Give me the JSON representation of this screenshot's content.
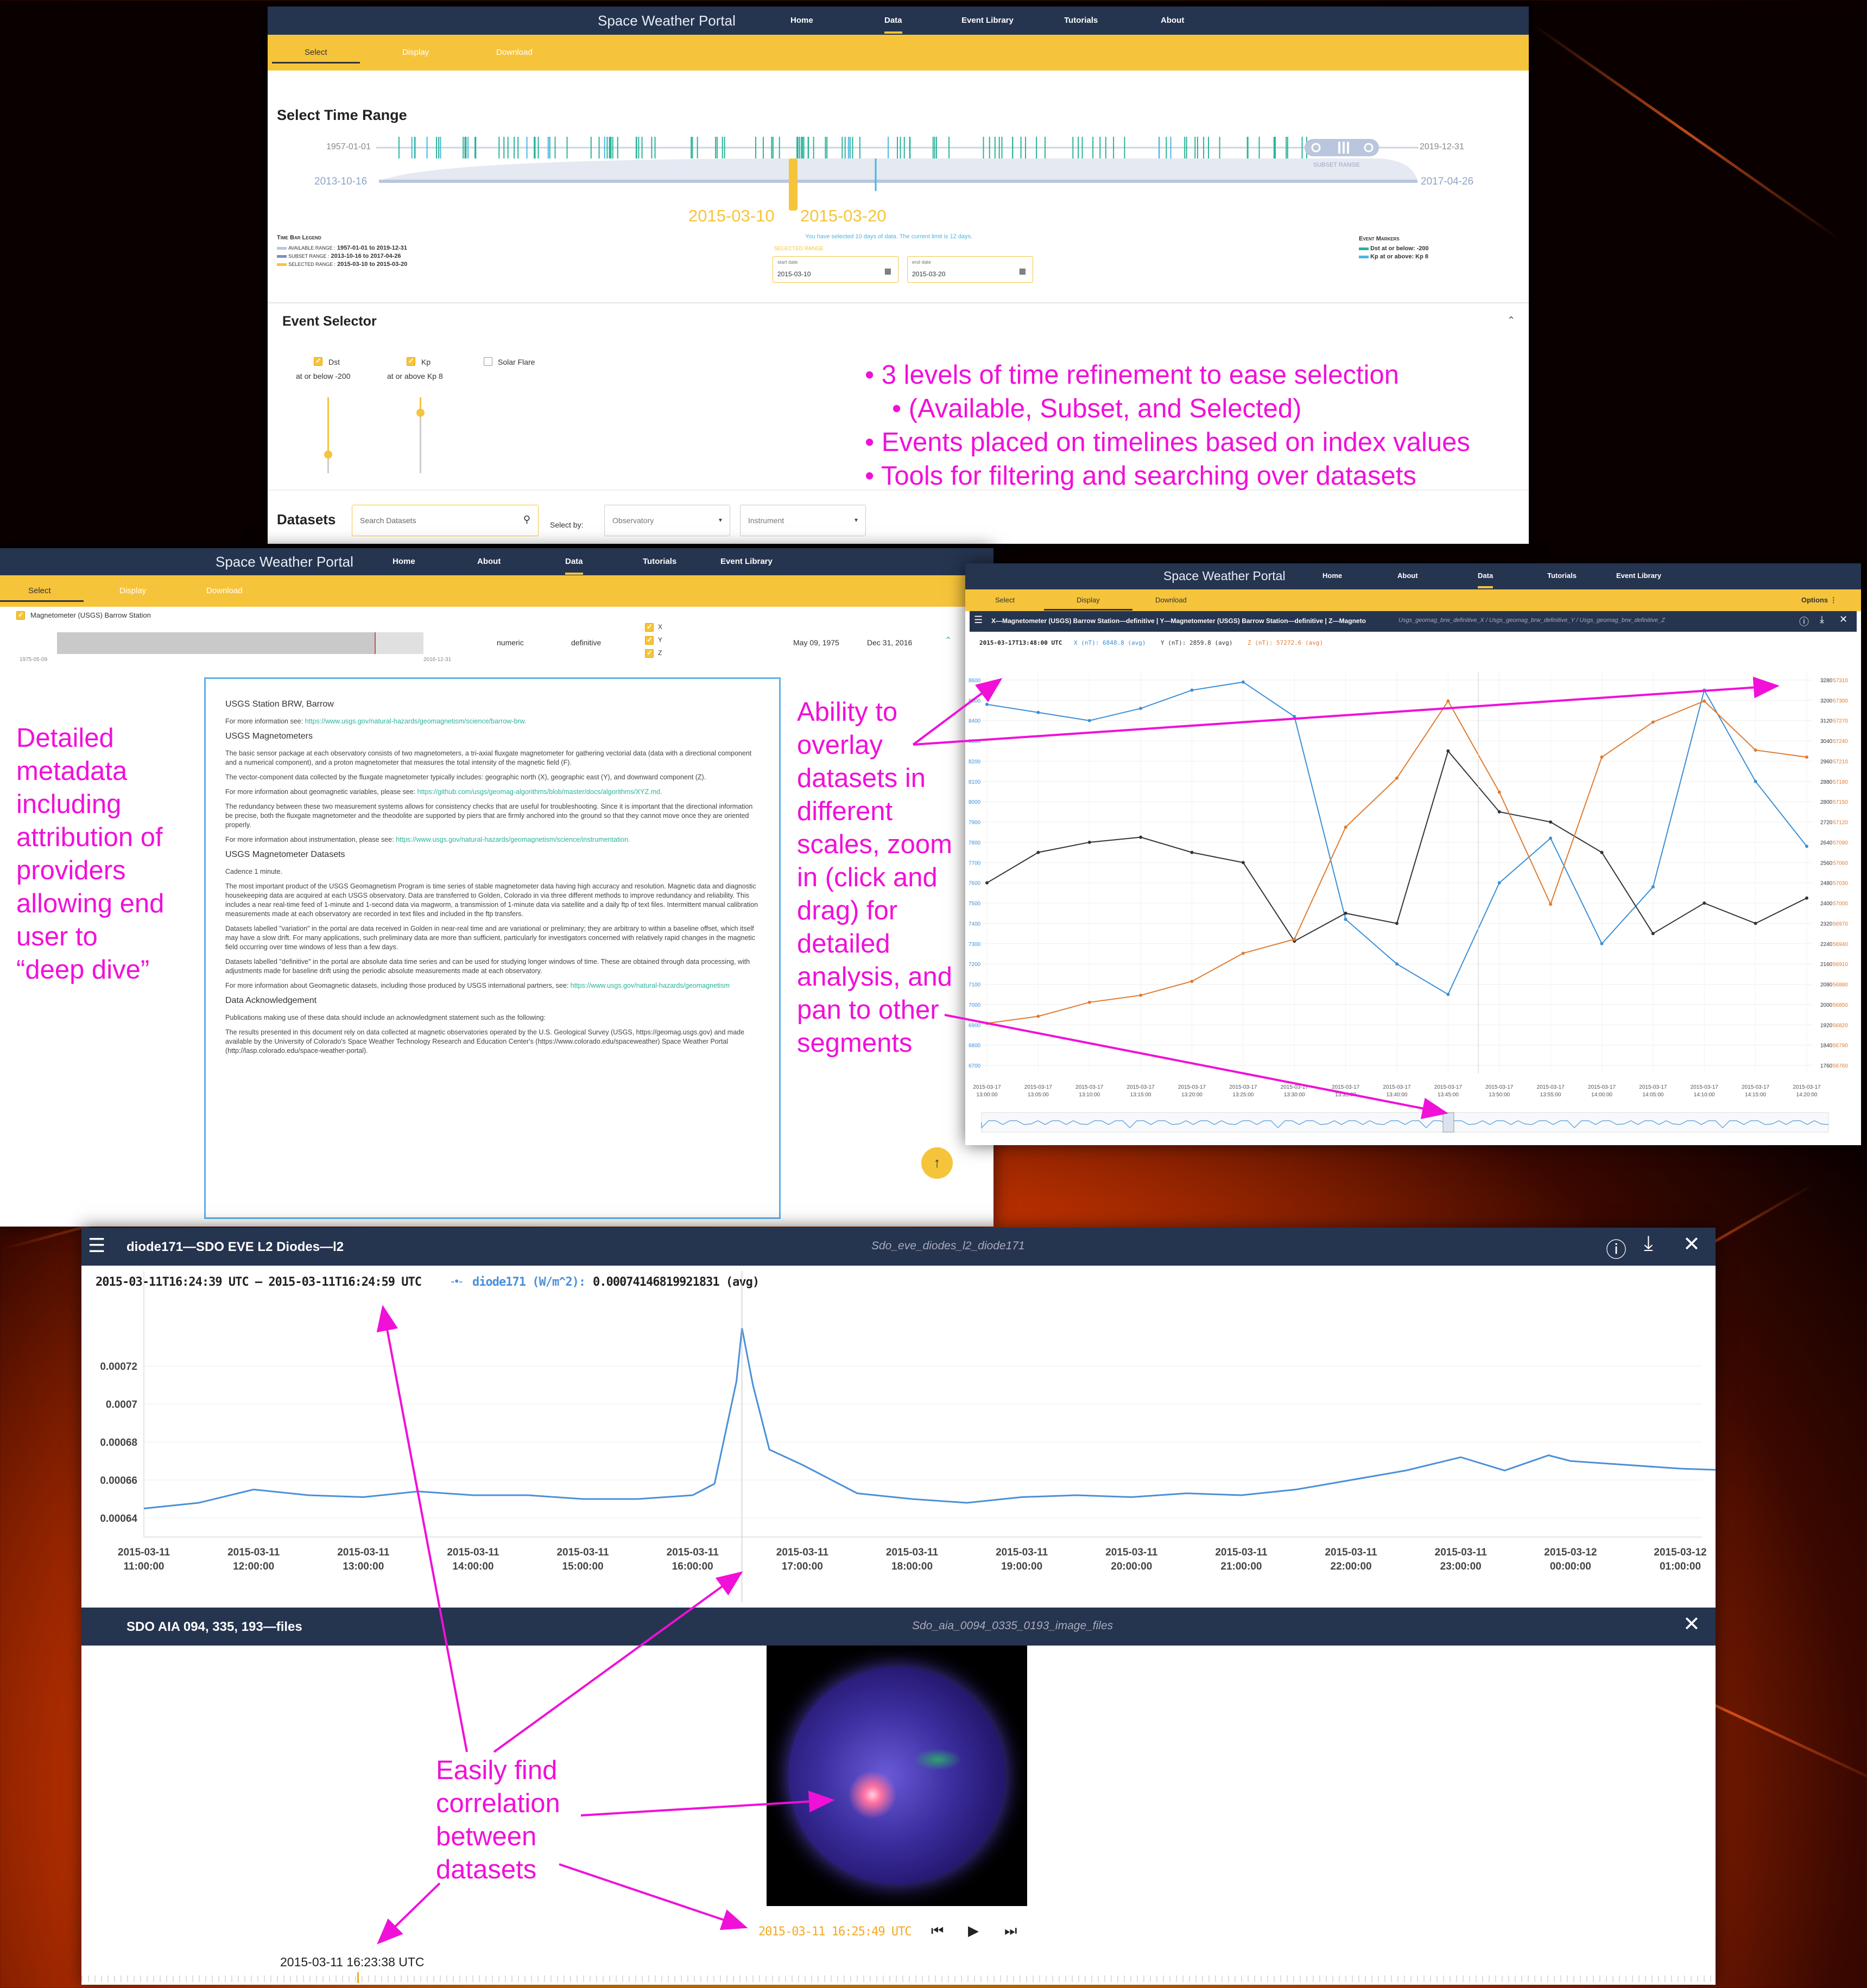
{
  "panel_top": {
    "brand": "Space Weather Portal",
    "nav": [
      "Home",
      "Data",
      "Event Library",
      "Tutorials",
      "About"
    ],
    "subtabs": [
      "Select",
      "Display",
      "Download"
    ],
    "heading": "Select Time Range",
    "available_start": "1957-01-01",
    "available_end": "2019-12-31",
    "subset_start": "2013-10-16",
    "subset_end": "2017-04-26",
    "subset_label": "SUBSET RANGE",
    "selected_start": "2015-03-10",
    "selected_end": "2015-03-20",
    "selected_note": "You have selected 10 days of data. The current limit is 12 days.",
    "selected_range_label": "SELECTED RANGE",
    "start_label": "start date",
    "end_label": "end date",
    "legend_title": "Time Bar Legend",
    "legend": [
      {
        "label": "AVAILABLE RANGE :",
        "value": "1957-01-01 to 2019-12-31",
        "color": "#b9c6dd"
      },
      {
        "label": "SUBSET RANGE :",
        "value": "2013-10-16 to 2017-04-26",
        "color": "#7d90b8"
      },
      {
        "label": "SELECTED RANGE :",
        "value": "2015-03-10 to 2015-03-20",
        "color": "#f6c43b"
      }
    ],
    "markers_title": "Event Markers",
    "markers": [
      {
        "label": "Dst at or below: -200",
        "color": "#2bb39a"
      },
      {
        "label": "Kp at or above: Kp 8",
        "color": "#48b6e6"
      }
    ],
    "event_selector": "Event Selector",
    "events": [
      {
        "name": "Dst",
        "sub": "at or below -200",
        "checked": true,
        "level": 0.25
      },
      {
        "name": "Kp",
        "sub": "at or above Kp 8",
        "checked": true,
        "level": 0.8
      },
      {
        "name": "Solar Flare",
        "sub": "",
        "checked": false
      }
    ],
    "datasets_label": "Datasets",
    "search_placeholder": "Search Datasets",
    "select_by": "Select by:",
    "observatory": "Observatory",
    "instrument": "Instrument",
    "bullets": [
      "3 levels of time refinement to ease selection",
      "(Available, Subset, and Selected)",
      "Events placed on timelines based on index values",
      "Tools for filtering and searching over datasets"
    ]
  },
  "panel_meta": {
    "brand": "Space Weather Portal",
    "nav": [
      "Home",
      "About",
      "Data",
      "Tutorials",
      "Event Library"
    ],
    "subtabs": [
      "Select",
      "Display",
      "Download"
    ],
    "dataset": "Magnetometer (USGS) Barrow Station",
    "range_start": "1975-05-09",
    "range_end": "2016-12-31",
    "type": "numeric",
    "quality": "definitive",
    "components": [
      "X",
      "Y",
      "Z"
    ],
    "date_start": "May 09, 1975",
    "date_end": "Dec 31, 2016",
    "title": "USGS Station BRW, Barrow",
    "more1": "For more information see: ",
    "url1": "https://www.usgs.gov/natural-hazards/geomagnetism/science/barrow-brw.",
    "h_magnetometers": "USGS Magnetometers",
    "p1": "The basic sensor package at each observatory consists of two magnetometers, a tri-axial fluxgate magnetometer for gathering vectorial data (data with a directional component and a numerical component), and a proton magnetometer that measures the total intensity of the magnetic field (F).",
    "p2": "The vector-component data collected by the fluxgate magnetometer typically includes: geographic north (X), geographic east (Y), and downward component (Z).",
    "p3a": "For more information about geomagnetic variables, please see: ",
    "url3": "https://github.com/usgs/geomag-algorithms/blob/master/docs/algorithms/XYZ.md.",
    "p4": "The redundancy between these two measurement systems allows for consistency checks that are useful for troubleshooting. Since it is important that the directional information be precise, both the fluxgate magnetometer and the theodolite are supported by piers that are firmly anchored into the ground so that they cannot move once they are oriented properly.",
    "p5a": "For more information about instrumentation, please see: ",
    "url5": "https://www.usgs.gov/natural-hazards/geomagnetism/science/instrumentation.",
    "h_datasets": "USGS Magnetometer Datasets",
    "cadence": "Cadence 1 minute.",
    "p6": "The most important product of the USGS Geomagnetism Program is time series of stable magnetometer data having high accuracy and resolution. Magnetic data and diagnostic housekeeping data are acquired at each USGS observatory. Data are transferred to Golden, Colorado in via three different methods to improve redundancy and reliability. This includes a near real-time feed of 1-minute and 1-second data via magworm, a transmission of 1-minute data via satellite and a daily ftp of text files. Intermittent manual calibration measurements made at each observatory are recorded in text files and included in the ftp transfers.",
    "p7": "Datasets labelled \"variation\" in the portal are data received in Golden in near-real time and are variational or preliminary; they are arbitrary to within a baseline offset, which itself may have a slow drift. For many applications, such preliminary data are more than sufficient, particularly for investigators concerned with relatively rapid changes in the magnetic field occurring over time windows of less than a few days.",
    "p8": "Datasets labelled \"definitive\" in the portal are absolute data time series and can be used for studying longer windows of time. These are obtained through data processing, with adjustments made for baseline drift using the periodic absolute measurements made at each observatory.",
    "p9a": "For more information about Geomagnetic datasets, including those produced by USGS international partners, see: ",
    "url9": "https://www.usgs.gov/natural-hazards/geomagnetism",
    "h_ack": "Data Acknowledgement",
    "p10": "Publications making use of these data should include an acknowledgment statement such as the following:",
    "p11": "The results presented in this document rely on data collected at magnetic observatories operated by the U.S. Geological Survey (USGS, https://geomag.usgs.gov) and made available by the University of Colorado's Space Weather Technology Research and Education Center's (https://www.colorado.edu/spaceweather) Space Weather Portal (http://lasp.colorado.edu/space-weather-portal).",
    "anno": [
      "Detailed",
      "metadata",
      "including",
      "attribution of",
      "providers",
      "allowing end",
      "user to",
      "“deep dive”"
    ]
  },
  "panel_mag": {
    "brand": "Space Weather Portal",
    "nav": [
      "Home",
      "About",
      "Data",
      "Tutorials",
      "Event Library"
    ],
    "subtabs": [
      "Select",
      "Display",
      "Download"
    ],
    "options": "Options ⋮",
    "title": "X—Magnetometer (USGS) Barrow Station—definitive | Y—Magnetometer (USGS) Barrow Station—definitive | Z—Magneto",
    "subtitle": "Usgs_geomag_brw_definitive_X / Usgs_geomag_brw_definitive_Y / Usgs_geomag_brw_definitive_Z",
    "readout_time": "2015-03-17T13:48:00 UTC",
    "readout": [
      {
        "text": "X (nT): 6848.8 (avg)",
        "color": "#3a8fd8"
      },
      {
        "text": "Y (nT): 2859.8 (avg)",
        "color": "#333"
      },
      {
        "text": "Z (nT): 57272.6 (avg)",
        "color": "#e07b30"
      }
    ],
    "anno": [
      "Ability to",
      "overlay",
      "datasets in",
      "different",
      "scales, zoom",
      "in (click and",
      "drag) for",
      "detailed",
      "analysis, and",
      "pan to other",
      "segments"
    ]
  },
  "chart_mag": {
    "type": "line",
    "x": [
      "2015-03-17 13:00:00",
      "2015-03-17 13:05:00",
      "2015-03-17 13:10:00",
      "2015-03-17 13:15:00",
      "2015-03-17 13:20:00",
      "2015-03-17 13:25:00",
      "2015-03-17 13:30:00",
      "2015-03-17 13:35:00",
      "2015-03-17 13:40:00",
      "2015-03-17 13:45:00",
      "2015-03-17 13:50:00",
      "2015-03-17 13:55:00",
      "2015-03-17 14:00:00",
      "2015-03-17 14:05:00",
      "2015-03-17 14:10:00",
      "2015-03-17 14:15:00",
      "2015-03-17 14:20:00"
    ],
    "left_ticks": [
      8600,
      8500,
      8400,
      8300,
      8200,
      8100,
      8000,
      7900,
      7800,
      7700,
      7600,
      7500,
      7400,
      7300,
      7200,
      7100,
      7000,
      6900,
      6800,
      6700
    ],
    "right1_ticks": [
      3280,
      3200,
      3120,
      3040,
      2960,
      2880,
      2800,
      2720,
      2640,
      2560,
      2480,
      2400,
      2320,
      2240,
      2160,
      2080,
      2000,
      1920,
      1840,
      1760
    ],
    "right2_ticks": [
      57310,
      57300,
      57270,
      57240,
      57210,
      57180,
      57150,
      57120,
      57090,
      57060,
      57030,
      57000,
      56970,
      56940,
      56910,
      56880,
      56850,
      56820,
      56790,
      56760
    ],
    "series": [
      {
        "name": "X (nT)",
        "color": "#3a8fd8",
        "values": [
          8480,
          8440,
          8400,
          8460,
          8550,
          8590,
          8420,
          7420,
          7200,
          7050,
          7600,
          7820,
          7300,
          7580,
          8550,
          8100,
          7780
        ]
      },
      {
        "name": "Y (nT)",
        "color": "#333333",
        "values": [
          2480,
          2600,
          2640,
          2660,
          2600,
          2560,
          2250,
          2360,
          2320,
          3000,
          2760,
          2720,
          2600,
          2280,
          2400,
          2320,
          2420
        ]
      },
      {
        "name": "Z (nT)",
        "color": "#e07b30",
        "values": [
          56820,
          56830,
          56850,
          56860,
          56880,
          56920,
          56940,
          57100,
          57170,
          57280,
          57150,
          56990,
          57200,
          57250,
          57280,
          57210,
          57200
        ]
      }
    ]
  },
  "panel_eve": {
    "title": "diode171—SDO EVE L2 Diodes—l2",
    "subtitle": "Sdo_eve_diodes_l2_diode171",
    "readout_range": "2015-03-11T16:24:39 UTC – 2015-03-11T16:24:59 UTC",
    "readout_series": "diode171 (W/m^2):",
    "readout_value": "0.00074146819921831 (avg)",
    "image_title": "SDO AIA 094, 335, 193—files",
    "image_subtitle": "Sdo_aia_0094_0335_0193_image_files",
    "image_time": "2015-03-11 16:25:49 UTC",
    "cursor_time": "2015-03-11 16:23:38 UTC",
    "anno": [
      "Easily find",
      "correlation",
      "between",
      "datasets"
    ]
  },
  "chart_eve": {
    "type": "line",
    "x": [
      "2015-03-11 11:00:00",
      "2015-03-11 12:00:00",
      "2015-03-11 13:00:00",
      "2015-03-11 14:00:00",
      "2015-03-11 15:00:00",
      "2015-03-11 16:00:00",
      "2015-03-11 17:00:00",
      "2015-03-11 18:00:00",
      "2015-03-11 19:00:00",
      "2015-03-11 20:00:00",
      "2015-03-11 21:00:00",
      "2015-03-11 22:00:00",
      "2015-03-11 23:00:00",
      "2015-03-12 00:00:00",
      "2015-03-12 01:00:00"
    ],
    "y_ticks": [
      "0.00072",
      "0.0007",
      "0.00068",
      "0.00066",
      "0.00064"
    ],
    "ylim": [
      0.00063,
      0.00075
    ],
    "color": "#4a90d9",
    "points": [
      [
        0,
        0.000645
      ],
      [
        0.5,
        0.000648
      ],
      [
        1,
        0.000655
      ],
      [
        1.5,
        0.000652
      ],
      [
        2,
        0.000651
      ],
      [
        2.5,
        0.000654
      ],
      [
        3,
        0.000652
      ],
      [
        3.5,
        0.000652
      ],
      [
        4,
        0.00065
      ],
      [
        4.5,
        0.00065
      ],
      [
        5,
        0.000652
      ],
      [
        5.2,
        0.000658
      ],
      [
        5.4,
        0.000712
      ],
      [
        5.45,
        0.00074
      ],
      [
        5.55,
        0.00071
      ],
      [
        5.7,
        0.000676
      ],
      [
        6,
        0.000668
      ],
      [
        6.5,
        0.000653
      ],
      [
        7,
        0.00065
      ],
      [
        7.5,
        0.000648
      ],
      [
        8,
        0.000651
      ],
      [
        8.5,
        0.000652
      ],
      [
        9,
        0.000651
      ],
      [
        9.5,
        0.000653
      ],
      [
        10,
        0.000652
      ],
      [
        10.5,
        0.000655
      ],
      [
        11,
        0.00066
      ],
      [
        11.5,
        0.000665
      ],
      [
        12,
        0.000672
      ],
      [
        12.4,
        0.000665
      ],
      [
        12.8,
        0.000673
      ],
      [
        13,
        0.00067
      ],
      [
        13.5,
        0.000668
      ],
      [
        14,
        0.000666
      ],
      [
        14.5,
        0.000665
      ]
    ]
  }
}
